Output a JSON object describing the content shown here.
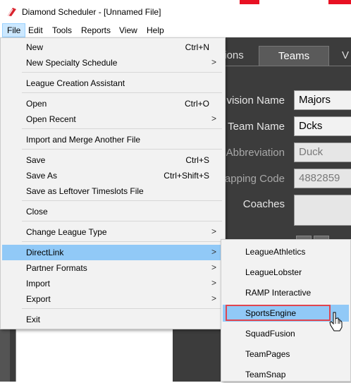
{
  "window": {
    "title": "Diamond Scheduler - [Unnamed File]"
  },
  "colors": {
    "menu_highlight": "#91c9f7",
    "focus_outline": "#e0454f",
    "app_background": "#3c3c3c",
    "title_close_red": "#e81123"
  },
  "menubar": {
    "items": [
      "File",
      "Edit",
      "Tools",
      "Reports",
      "View",
      "Help"
    ]
  },
  "background": {
    "tabs": [
      "ions",
      "Teams",
      "V"
    ],
    "form": {
      "division_label": "vision Name",
      "division_value": "Majors",
      "team_label": "Team Name",
      "team_value": "Dcks",
      "abbr_label": "Abbreviation",
      "abbr_value": "Duck",
      "mapping_label": "apping Code",
      "mapping_value": "4882859",
      "coaches_label": "Coaches"
    }
  },
  "file_menu": {
    "new": {
      "label": "New",
      "shortcut": "Ctrl+N"
    },
    "new_specialty": {
      "label": "New Specialty Schedule"
    },
    "league_assistant": {
      "label": "League Creation Assistant"
    },
    "open": {
      "label": "Open",
      "shortcut": "Ctrl+O"
    },
    "open_recent": {
      "label": "Open Recent"
    },
    "import_merge": {
      "label": "Import and Merge Another File"
    },
    "save": {
      "label": "Save",
      "shortcut": "Ctrl+S"
    },
    "save_as": {
      "label": "Save As",
      "shortcut": "Ctrl+Shift+S"
    },
    "save_leftover": {
      "label": "Save as Leftover Timeslots File"
    },
    "close": {
      "label": "Close"
    },
    "change_league_type": {
      "label": "Change League Type"
    },
    "directlink": {
      "label": "DirectLink"
    },
    "partner_formats": {
      "label": "Partner Formats"
    },
    "import": {
      "label": "Import"
    },
    "export": {
      "label": "Export"
    },
    "exit": {
      "label": "Exit"
    },
    "submenu_arrow": ">"
  },
  "directlink_menu": {
    "items": [
      "LeagueAthletics",
      "LeagueLobster",
      "RAMP Interactive",
      "SportsEngine",
      "SquadFusion",
      "TeamPages",
      "TeamSnap"
    ]
  },
  "icons": {
    "app": "baseball-diamond-icon",
    "cursor": "mouse-pointer-icon",
    "add": "plus-icon",
    "remove": "x-icon"
  }
}
